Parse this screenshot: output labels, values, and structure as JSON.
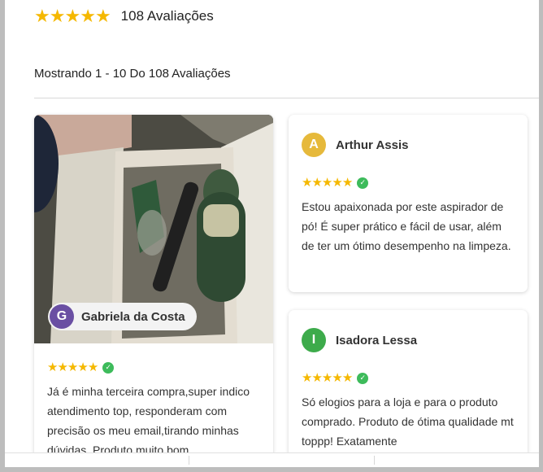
{
  "summary": {
    "stars": 5,
    "count_label": "108 Avaliações"
  },
  "showing_label": "Mostrando 1 - 10 Do 108 Avaliações",
  "colors": {
    "star": "#f5b800",
    "verified": "#3dbb5b"
  },
  "reviews": [
    {
      "initial": "G",
      "name": "Gabriela da Costa",
      "avatar_color": "#6a4fa3",
      "has_photo": true,
      "stars": 5,
      "text": "Já é minha terceira compra,super indico atendimento top, responderam com precisão os meu email,tirando minhas dúvidas. Produto muito bom."
    },
    {
      "initial": "A",
      "name": "Arthur Assis",
      "avatar_color": "#e6b93b",
      "stars": 5,
      "text": "Estou apaixonada por este aspirador de pó! É super prático e fácil de usar, além de ter um ótimo desempenho na limpeza."
    },
    {
      "initial": "I",
      "name": "Isadora Lessa",
      "avatar_color": "#3dab4b",
      "stars": 5,
      "text": "Só elogios para a loja e para o produto comprado. Produto de ótima qualidade mt toppp! Exatamente"
    }
  ]
}
